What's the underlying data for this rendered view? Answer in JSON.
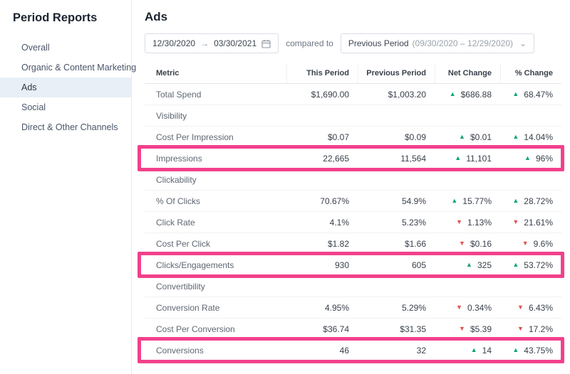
{
  "sidebar": {
    "title": "Period Reports",
    "items": [
      {
        "label": "Overall",
        "active": false
      },
      {
        "label": "Organic & Content Marketing",
        "active": false
      },
      {
        "label": "Ads",
        "active": true
      },
      {
        "label": "Social",
        "active": false
      },
      {
        "label": "Direct & Other Channels",
        "active": false
      }
    ]
  },
  "page": {
    "title": "Ads"
  },
  "controls": {
    "date_start": "12/30/2020",
    "date_arrow": "→",
    "date_end": "03/30/2021",
    "compared_to": "compared to",
    "comparison_label": "Previous Period",
    "comparison_range": "(09/30/2020 – 12/29/2020)"
  },
  "table": {
    "columns": [
      "Metric",
      "This Period",
      "Previous Period",
      "Net Change",
      "% Change"
    ],
    "rows": [
      {
        "type": "metric",
        "label": "Total Spend",
        "this_period": "$1,690.00",
        "previous_period": "$1,003.20",
        "net_change": "$686.88",
        "net_dir": "up",
        "pct_change": "68.47%",
        "pct_dir": "up",
        "highlight": false
      },
      {
        "type": "section",
        "label": "Visibility"
      },
      {
        "type": "metric",
        "label": "Cost Per Impression",
        "this_period": "$0.07",
        "previous_period": "$0.09",
        "net_change": "$0.01",
        "net_dir": "up",
        "pct_change": "14.04%",
        "pct_dir": "up",
        "highlight": false
      },
      {
        "type": "metric",
        "label": "Impressions",
        "this_period": "22,665",
        "previous_period": "11,564",
        "net_change": "11,101",
        "net_dir": "up",
        "pct_change": "96%",
        "pct_dir": "up",
        "highlight": true
      },
      {
        "type": "section",
        "label": "Clickability"
      },
      {
        "type": "metric",
        "label": "% Of Clicks",
        "this_period": "70.67%",
        "previous_period": "54.9%",
        "net_change": "15.77%",
        "net_dir": "up",
        "pct_change": "28.72%",
        "pct_dir": "up",
        "highlight": false
      },
      {
        "type": "metric",
        "label": "Click Rate",
        "this_period": "4.1%",
        "previous_period": "5.23%",
        "net_change": "1.13%",
        "net_dir": "down",
        "pct_change": "21.61%",
        "pct_dir": "down",
        "highlight": false
      },
      {
        "type": "metric",
        "label": "Cost Per Click",
        "this_period": "$1.82",
        "previous_period": "$1.66",
        "net_change": "$0.16",
        "net_dir": "down",
        "pct_change": "9.6%",
        "pct_dir": "down",
        "highlight": false
      },
      {
        "type": "metric",
        "label": "Clicks/Engagements",
        "this_period": "930",
        "previous_period": "605",
        "net_change": "325",
        "net_dir": "up",
        "pct_change": "53.72%",
        "pct_dir": "up",
        "highlight": true
      },
      {
        "type": "section",
        "label": "Convertibility"
      },
      {
        "type": "metric",
        "label": "Conversion Rate",
        "this_period": "4.95%",
        "previous_period": "5.29%",
        "net_change": "0.34%",
        "net_dir": "down",
        "pct_change": "6.43%",
        "pct_dir": "down",
        "highlight": false
      },
      {
        "type": "metric",
        "label": "Cost Per Conversion",
        "this_period": "$36.74",
        "previous_period": "$31.35",
        "net_change": "$5.39",
        "net_dir": "down",
        "pct_change": "17.2%",
        "pct_dir": "down",
        "highlight": false
      },
      {
        "type": "metric",
        "label": "Conversions",
        "this_period": "46",
        "previous_period": "32",
        "net_change": "14",
        "net_dir": "up",
        "pct_change": "43.75%",
        "pct_dir": "up",
        "highlight": true
      }
    ]
  },
  "icons": {
    "caret_up": "▲",
    "caret_down": "▼",
    "chevron_down": "⌄",
    "calendar": "calendar-icon"
  },
  "colors": {
    "positive": "#0aa574",
    "negative": "#e0524e",
    "highlight": "#f2418c",
    "active_nav_bg": "#e8eff6"
  }
}
